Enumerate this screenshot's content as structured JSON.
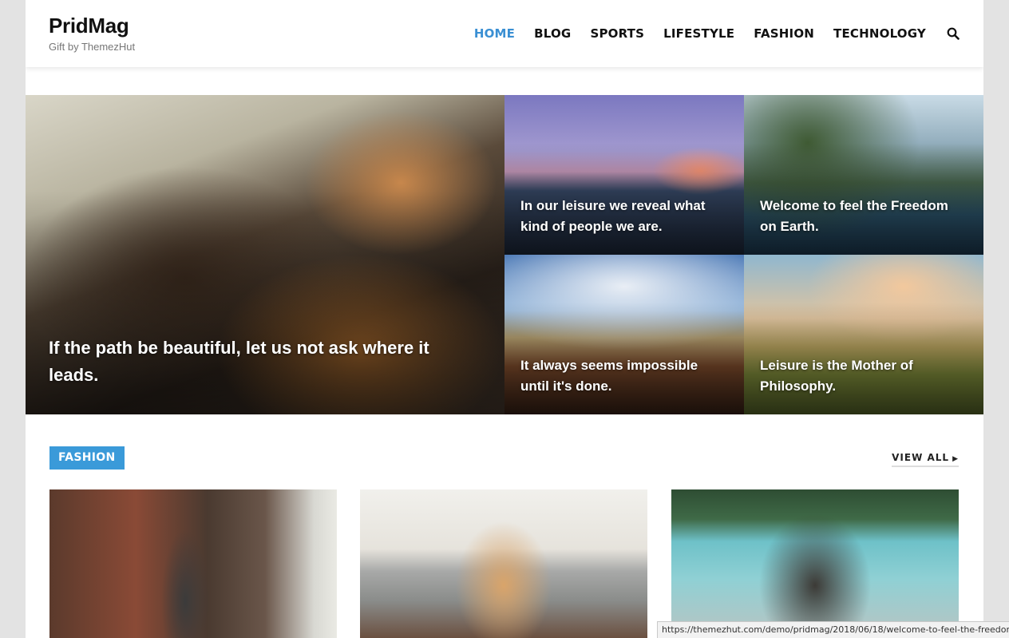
{
  "site": {
    "title": "PridMag",
    "tagline": "Gift by ThemezHut"
  },
  "nav": {
    "items": [
      {
        "label": "HOME",
        "active": true
      },
      {
        "label": "BLOG"
      },
      {
        "label": "SPORTS"
      },
      {
        "label": "LIFESTYLE"
      },
      {
        "label": "FASHION"
      },
      {
        "label": "TECHNOLOGY"
      }
    ],
    "search_icon": "search-icon",
    "accent_color": "#3a8fd3"
  },
  "hero": {
    "main": {
      "caption": "If the path be beautiful, let us not ask where it leads."
    },
    "tiles": [
      {
        "caption": "In our leisure we reveal what kind of people we are."
      },
      {
        "caption": "Welcome to feel the Freedom on Earth."
      },
      {
        "caption": "It always seems impossible until it's done."
      },
      {
        "caption": "Leisure is the Mother of Philosophy."
      }
    ]
  },
  "fashion_section": {
    "label": "FASHION",
    "label_color": "#3a9ad9",
    "view_all": "VIEW ALL"
  },
  "status_bar": {
    "url": "https://themezhut.com/demo/pridmag/2018/06/18/welcome-to-feel-the-freedor"
  }
}
